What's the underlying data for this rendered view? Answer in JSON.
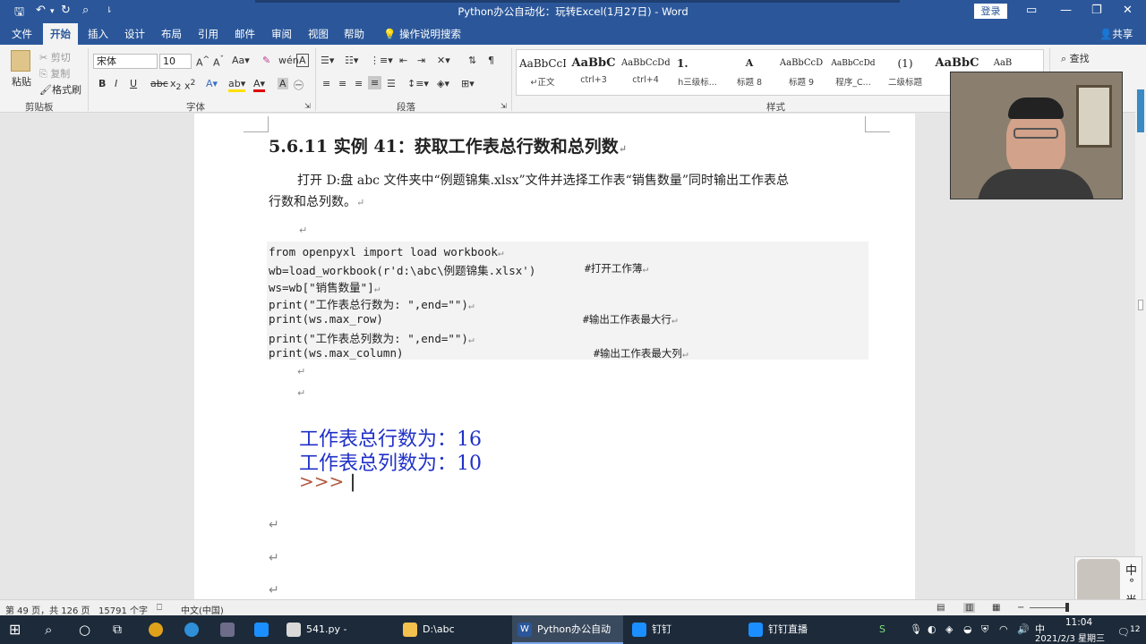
{
  "titlebar": {
    "title": "Python办公自动化：玩转Excel(1月27日)  -  Word",
    "login": "登录",
    "qa_icons": [
      "save-icon",
      "undo-icon",
      "redo-icon",
      "print-preview-icon",
      "customize-icon"
    ]
  },
  "tabs": [
    "文件",
    "开始",
    "插入",
    "设计",
    "布局",
    "引用",
    "邮件",
    "审阅",
    "视图",
    "帮助"
  ],
  "tell_me": "操作说明搜索",
  "share": "共享",
  "ribbon": {
    "clipboard": {
      "paste": "粘贴",
      "cut": "剪切",
      "copy": "复制",
      "format_painter": "格式刷",
      "label": "剪贴板"
    },
    "font": {
      "name": "宋体",
      "size": "10",
      "label": "字体"
    },
    "paragraph": {
      "label": "段落"
    },
    "styles": {
      "label": "样式"
    },
    "find": "查找",
    "style_items": [
      {
        "sample": "AaBbCcD",
        "name": "↵正文"
      },
      {
        "sample": "AaBbC",
        "name": "ctrl+3"
      },
      {
        "sample": "AaBbCcDdE",
        "name": "ctrl+4"
      },
      {
        "sample": "1.",
        "name": "h三级标..."
      },
      {
        "sample": "A",
        "name": "标题 8"
      },
      {
        "sample": "AaBbCcD",
        "name": "标题 9"
      },
      {
        "sample": "AaBbCcDd",
        "name": "程序_C..."
      },
      {
        "sample": "(1)",
        "name": "二级标题"
      },
      {
        "sample": "AaBbC",
        "name": ""
      },
      {
        "sample": "AaB",
        "name": ""
      }
    ]
  },
  "doc": {
    "heading": "5.6.11 实例 41：获取工作表总行数和总列数",
    "para_line1": "打开 D:盘 abc 文件夹中“例题锦集.xlsx”文件并选择工作表“销售数量”同时输出工作表总",
    "para_line2": "行数和总列数。",
    "code": [
      "from openpyxl import load workbook",
      "wb=load_workbook(r'd:\\abc\\例题锦集.xlsx')",
      "ws=wb[\"销售数量\"]",
      "print(\"工作表总行数为: \",end=\"\")",
      "print(ws.max_row)",
      "print(\"工作表总列数为: \",end=\"\")",
      "print(ws.max_column)"
    ],
    "comments": {
      "line2": "#打开工作薄",
      "line5": "#输出工作表最大行",
      "line7": "#输出工作表最大列"
    },
    "output_line1": "工作表总行数为：16",
    "output_line2": "工作表总列数为：10",
    "prompt": ">>>",
    "para_mark": "↵"
  },
  "statusbar": {
    "page": "第 49 页，共 126 页",
    "words": "15791 个字",
    "lang": "中文(中国)"
  },
  "ime": {
    "line1": "中",
    "line2": "°",
    "line3": "半"
  },
  "taskbar": {
    "items": [
      {
        "label": "541.py - C:/Users..."
      },
      {
        "label": "D:\\abc"
      },
      {
        "label": "Python办公自动化..."
      },
      {
        "label": "钉钉"
      },
      {
        "label": "钉钉直播"
      }
    ],
    "time": "11:04",
    "date": "2021/2/3 星期三",
    "notif_count": "12"
  },
  "colors": {
    "word_blue": "#2b579a",
    "output_blue": "#2030c8",
    "taskbar": "#1c2a3a"
  }
}
